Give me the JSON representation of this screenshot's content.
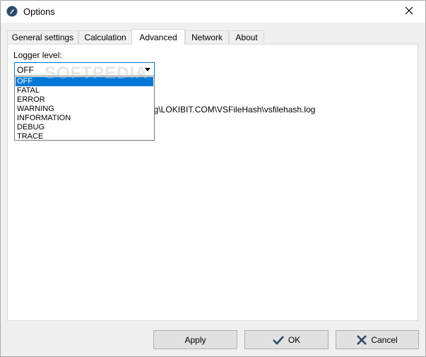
{
  "window": {
    "title": "Options"
  },
  "tabs": [
    {
      "label": "General settings"
    },
    {
      "label": "Calculation"
    },
    {
      "label": "Advanced",
      "active": true
    },
    {
      "label": "Network"
    },
    {
      "label": "About"
    }
  ],
  "advanced": {
    "logger_label": "Logger level:",
    "logger_value": "OFF",
    "logger_options": [
      "OFF",
      "FATAL",
      "ERROR",
      "WARNING",
      "INFORMATION",
      "DEBUG",
      "TRACE"
    ],
    "path_visible": "ng\\LOKIBIT.COM\\VSFileHash\\vsfilehash.log"
  },
  "watermark": "SOFTPEDIA",
  "buttons": {
    "apply": "Apply",
    "ok": "OK",
    "cancel": "Cancel"
  },
  "icons": {
    "app": "app-icon",
    "close": "close-icon",
    "ok": "check-icon",
    "cancel": "x-icon"
  },
  "colors": {
    "accent": "#0078d7"
  }
}
